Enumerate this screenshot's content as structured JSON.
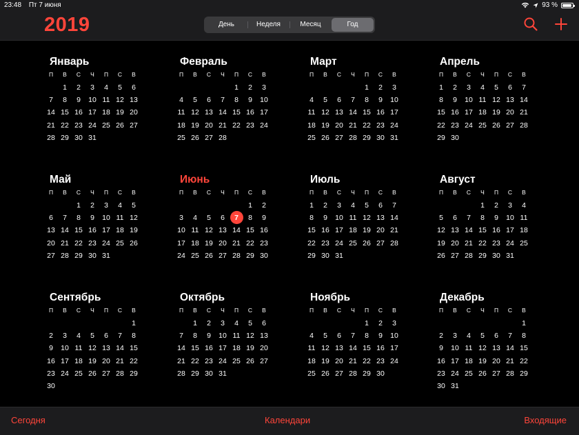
{
  "status_bar": {
    "time": "23:48",
    "date": "Пт 7 июня",
    "battery": "93 %",
    "battery_level": 0.93
  },
  "header": {
    "year": "2019",
    "segments": [
      "День",
      "Неделя",
      "Месяц",
      "Год"
    ],
    "active_segment": "Год",
    "icons": [
      "search-icon",
      "plus-icon"
    ],
    "accent_color": "#ff453a"
  },
  "weekdays": [
    "П",
    "В",
    "С",
    "Ч",
    "П",
    "С",
    "В"
  ],
  "today": {
    "month_index": 5,
    "day": 7
  },
  "months": [
    {
      "name": "Январь",
      "offset": 1,
      "days": 31
    },
    {
      "name": "Февраль",
      "offset": 4,
      "days": 28
    },
    {
      "name": "Март",
      "offset": 4,
      "days": 31
    },
    {
      "name": "Апрель",
      "offset": 0,
      "days": 30
    },
    {
      "name": "Май",
      "offset": 2,
      "days": 31
    },
    {
      "name": "Июнь",
      "offset": 5,
      "days": 30
    },
    {
      "name": "Июль",
      "offset": 0,
      "days": 31
    },
    {
      "name": "Август",
      "offset": 3,
      "days": 31
    },
    {
      "name": "Сентябрь",
      "offset": 6,
      "days": 30
    },
    {
      "name": "Октябрь",
      "offset": 1,
      "days": 31
    },
    {
      "name": "Ноябрь",
      "offset": 4,
      "days": 30
    },
    {
      "name": "Декабрь",
      "offset": 6,
      "days": 31
    }
  ],
  "bottom_bar": {
    "today": "Сегодня",
    "calendars": "Календари",
    "inbox": "Входящие"
  }
}
